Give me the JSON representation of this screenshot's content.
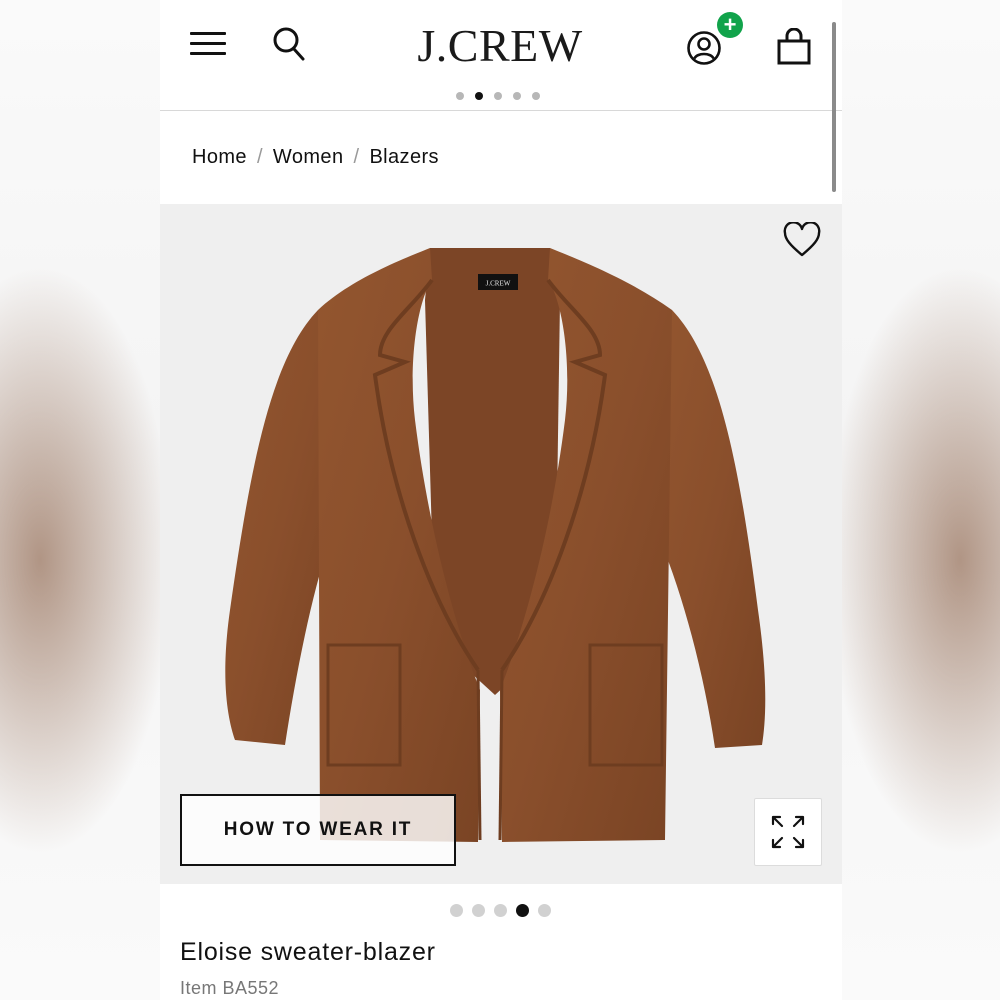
{
  "app": {
    "brand": "J.CREW"
  },
  "header": {
    "promo_dot_count": 5,
    "promo_active_index": 1
  },
  "breadcrumb": [
    {
      "label": "Home"
    },
    {
      "label": "Women"
    },
    {
      "label": "Blazers"
    }
  ],
  "product": {
    "name": "Eloise sweater-blazer",
    "item_number": "Item BA552",
    "label_tag": "J.CREW",
    "image_dot_count": 5,
    "image_active_index": 3,
    "color": "#8a4f2c"
  },
  "actions": {
    "how_to_wear_label": "HOW TO WEAR IT"
  },
  "icons": {
    "menu": "hamburger-menu-icon",
    "search": "search-icon",
    "account": "account-icon",
    "account_badge": "plus-badge-icon",
    "bag": "shopping-bag-icon",
    "wishlist": "heart-icon",
    "expand": "expand-icon"
  },
  "colors": {
    "badge_green": "#11a34b",
    "text": "#111111",
    "muted": "#777777",
    "image_bg": "#efefef"
  }
}
